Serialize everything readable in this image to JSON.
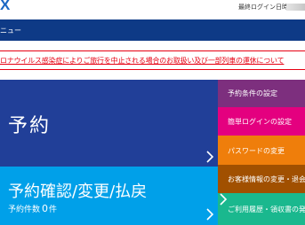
{
  "header": {
    "logo_text": "X",
    "last_login_label": "最終ログイン日時",
    "brand_color": "#1a67c4"
  },
  "menu": {
    "label": "ニュー"
  },
  "notice": {
    "text": "ロナウイルス感染症によりご旅行を中止される場合のお取扱い及び一部列車の運休について",
    "color": "#e60012"
  },
  "tiles": {
    "reserve": {
      "title": "予約",
      "color": "#213f98"
    },
    "confirm": {
      "title": "予約確認/変更/払戻",
      "count_label": "予約件数",
      "count_value": "0",
      "count_unit": "件",
      "color": "#00a0e9"
    }
  },
  "side_menu": [
    {
      "label": "予約条件の設定",
      "color": "#7d2f7e"
    },
    {
      "label": "簡単ログインの設定",
      "color": "#e4007f"
    },
    {
      "label": "パスワードの変更",
      "color": "#ef7e0b"
    },
    {
      "label": "お客様情報の変更・退会",
      "color": "#a15000"
    },
    {
      "label": "ご利用履歴・領収書の発",
      "color": "#1ab88e"
    }
  ],
  "icons": {
    "tile_arrow": "chevron-right-icon"
  }
}
